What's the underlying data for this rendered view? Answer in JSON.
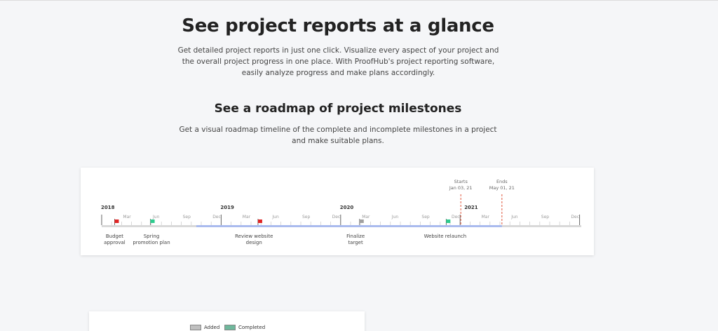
{
  "header": {
    "title": "See project reports at a glance",
    "description": "Get detailed project reports in just one click. Visualize every aspect of your project and the overall project progress in one place. With ProofHub's project reporting software, easily analyze progress and make plans accordingly."
  },
  "roadmap_section": {
    "title": "See a roadmap of project milestones",
    "description": "Get a visual roadmap timeline of the complete and incomplete milestones in a project and make suitable plans."
  },
  "timeline": {
    "years": [
      "2018",
      "2019",
      "2020",
      "2021"
    ],
    "month_labels": [
      "Mar",
      "Jun",
      "Sep",
      "Dec"
    ],
    "starts": {
      "label": "Starts",
      "date": "Jan 03, 21"
    },
    "ends": {
      "label": "Ends",
      "date": "May 01, 21"
    },
    "milestones": [
      {
        "line1": "Budget",
        "line2": "approval",
        "flag": "red"
      },
      {
        "line1": "Spring",
        "line2": "promotion plan",
        "flag": "green"
      },
      {
        "line1": "Review website",
        "line2": "design",
        "flag": "red"
      },
      {
        "line1": "Finalize",
        "line2": "target",
        "flag": "gray"
      },
      {
        "line1": "Website relaunch",
        "line2": "",
        "flag": "green"
      }
    ],
    "colors": {
      "red": "#e02424",
      "green": "#2ecc8f",
      "gray": "#a0a0a0",
      "progress": "#aabbee",
      "track": "#d9d9d9",
      "marker": "#e0553a"
    }
  },
  "legend": {
    "added": {
      "label": "Added",
      "color": "#c0c0c0"
    },
    "completed": {
      "label": "Completed",
      "color": "#6fb89c"
    }
  }
}
